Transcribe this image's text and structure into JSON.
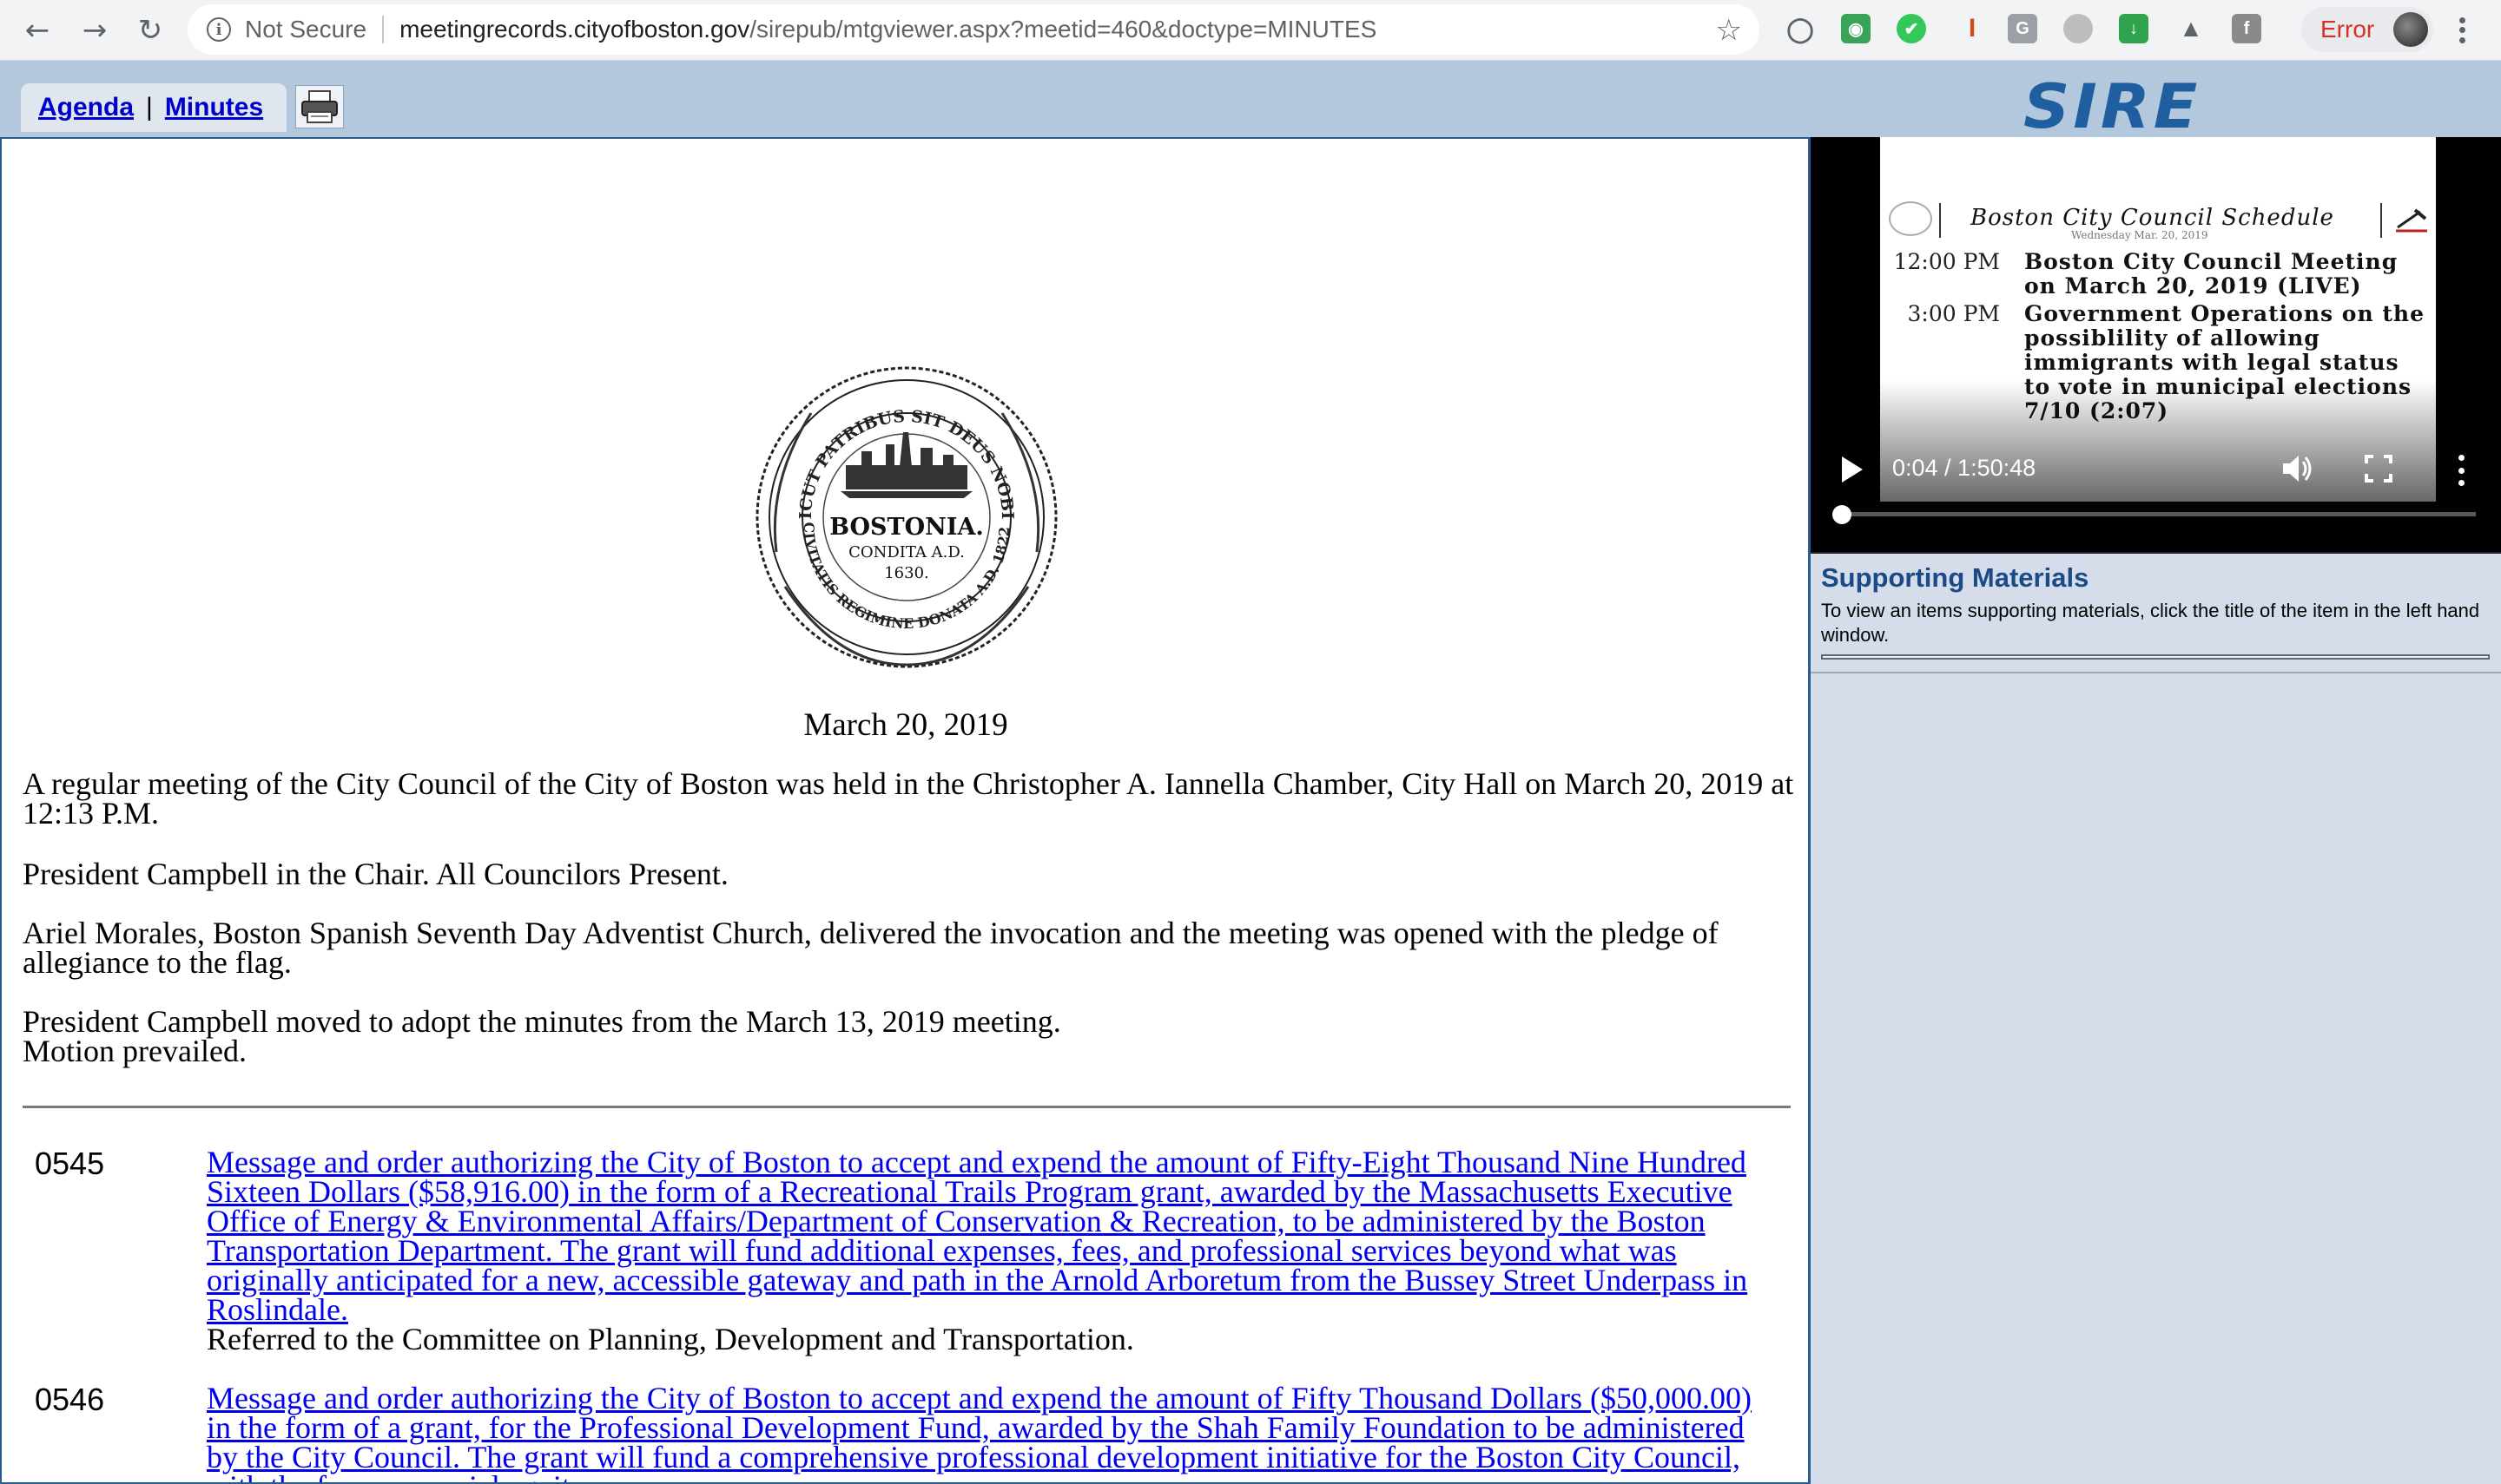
{
  "browser": {
    "security_label": "Not Secure",
    "url_host": "meetingrecords.cityofboston.gov",
    "url_path": "/sirepub/mtgviewer.aspx?meetid=460&doctype=MINUTES",
    "error_label": "Error"
  },
  "header": {
    "tab_agenda": "Agenda",
    "tab_separator": "|",
    "tab_minutes": "Minutes",
    "logo_text": "SIRE"
  },
  "seal": {
    "outer_text": "SICUT PATRIBUS SIT DEUS NOBIS",
    "lower_text": "CIVITATIS REGIMINE DONATA A.D. 1822.",
    "center_line1": "BOSTONIA.",
    "center_line2": "CONDITA A.D.",
    "center_line3": "1630."
  },
  "minutes": {
    "date": "March 20, 2019",
    "paragraphs": [
      "A regular meeting of the City Council of the City of Boston was held in the Christopher A. Iannella Chamber, City Hall on March 20, 2019 at 12:13 P.M.",
      "President Campbell in the Chair. All Councilors Present.",
      "Ariel Morales, Boston Spanish Seventh Day Adventist Church, delivered the invocation and the meeting was opened with the pledge of allegiance to the flag.",
      "President Campbell moved to adopt the minutes from the March 13, 2019 meeting.",
      "Motion prevailed."
    ],
    "items": [
      {
        "number": "0545",
        "title": "Message and order authorizing the City of Boston to accept and expend the amount of Fifty-Eight Thousand Nine Hundred Sixteen Dollars ($58,916.00) in the form of a Recreational Trails Program grant, awarded by the Massachusetts Executive Office of Energy & Environmental Affairs/Department of Conservation & Recreation, to be administered by the Boston Transportation Department. The grant will fund additional expenses, fees, and professional services beyond what was originally anticipated for a new, accessible gateway and path in the Arnold Arboretum from the Bussey Street Underpass in Roslindale.",
        "action": "Referred to the Committee on Planning, Development and Transportation."
      },
      {
        "number": "0546",
        "title": "Message and order authorizing the City of Boston to accept and expend the amount of Fifty Thousand Dollars ($50,000.00) in the form of a grant, for the Professional Development Fund, awarded by the Shah Family Foundation to be administered by the City Council. The grant will fund a comprehensive professional development initiative for the Boston City Council, with the focus on racial equity.",
        "action": ""
      }
    ]
  },
  "video": {
    "schedule_title": "Boston City Council Schedule",
    "schedule_date": "Wednesday Mar. 20, 2019",
    "rows": [
      {
        "time": "12:00 PM",
        "desc": "Boston City Council Meeting on March 20, 2019 (LIVE)"
      },
      {
        "time": "3:00 PM",
        "desc": "Government Operations on the possiblility of allowing immigrants with legal status to vote in municipal elections 7/10 (2:07)"
      }
    ],
    "time_display": "0:04 / 1:50:48",
    "progress_fraction": 0.0006
  },
  "supporting": {
    "title": "Supporting Materials",
    "description": "To view an items supporting materials, click the title of the item in the left hand window."
  },
  "icons": {
    "back": "arrow-left-icon",
    "forward": "arrow-right-icon",
    "reload": "reload-icon",
    "star": "star-icon",
    "print": "printer-icon",
    "play": "play-icon",
    "volume": "volume-icon",
    "fullscreen": "fullscreen-icon",
    "more": "more-vert-icon"
  },
  "colors": {
    "header_bg": "#b3c7dd",
    "link": "#0000ee",
    "panel_border": "#2b5c91",
    "supporting_title": "#1b4a86",
    "right_bg": "#d5dcea"
  }
}
